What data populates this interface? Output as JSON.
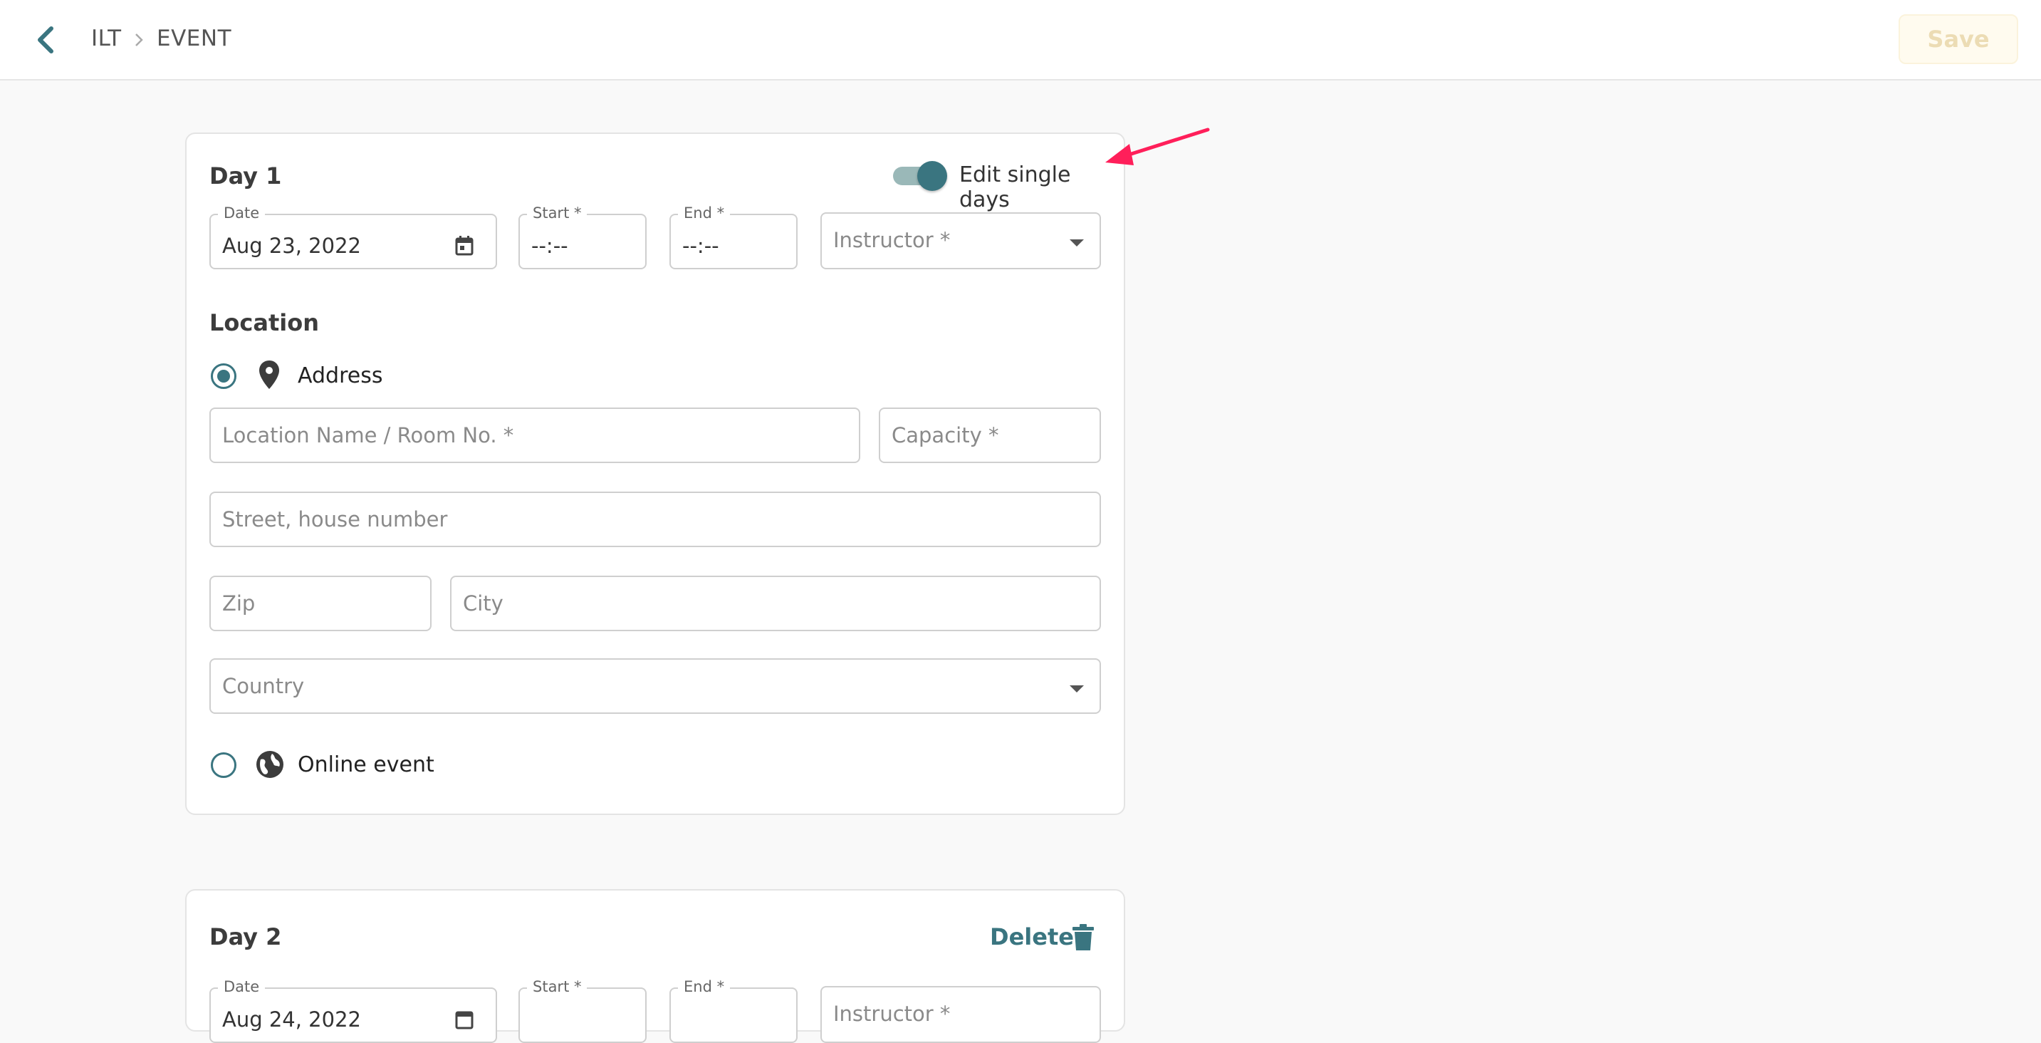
{
  "header": {
    "breadcrumb": [
      "ILT",
      "EVENT"
    ],
    "save_label": "Save"
  },
  "colors": {
    "accent": "#3a7580",
    "annotation_arrow": "#ff1f5a",
    "save_disabled_bg": "#fffbef"
  },
  "day1": {
    "title": "Day 1",
    "toggle_label": "Edit single days",
    "toggle_on": true,
    "date": {
      "label": "Date",
      "value": "Aug 23, 2022"
    },
    "start": {
      "label": "Start *",
      "value": "--:--"
    },
    "end": {
      "label": "End *",
      "value": "--:--"
    },
    "instructor": {
      "placeholder": "Instructor *"
    },
    "location": {
      "title": "Location",
      "address_option": {
        "label": "Address",
        "selected": true
      },
      "location_name": {
        "placeholder": "Location Name / Room No. *"
      },
      "capacity": {
        "placeholder": "Capacity *"
      },
      "street": {
        "placeholder": "Street, house number"
      },
      "zip": {
        "placeholder": "Zip"
      },
      "city": {
        "placeholder": "City"
      },
      "country": {
        "placeholder": "Country"
      },
      "online_option": {
        "label": "Online event",
        "selected": false
      }
    }
  },
  "day2": {
    "title": "Day 2",
    "delete_label": "Delete",
    "date": {
      "label": "Date",
      "value": "Aug 24, 2022"
    },
    "start": {
      "label": "Start *"
    },
    "end": {
      "label": "End *"
    },
    "instructor": {
      "placeholder": "Instructor *"
    }
  }
}
